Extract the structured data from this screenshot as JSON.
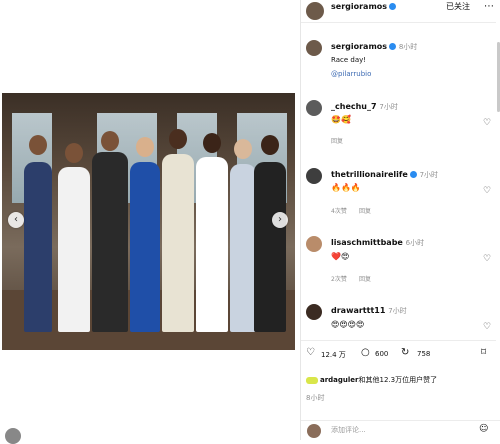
{
  "header": {
    "username": "sergioramos",
    "follow_label": "已关注",
    "more_icon": "more-icon"
  },
  "caption": {
    "username": "sergioramos",
    "time": "8小时",
    "text": "Race day!",
    "mention": "@pilarrubio"
  },
  "comments": [
    {
      "username": "_chechu_7",
      "time": "7小时",
      "emojis": "🤩🥰",
      "sub": [
        "回复"
      ]
    },
    {
      "username": "thetrillionairelife",
      "time": "7小时",
      "emojis": "🔥🔥🔥",
      "sub": [
        "4次赞",
        "回复"
      ]
    },
    {
      "username": "lisaschmittbabe",
      "time": "6小时",
      "emojis": "❤️😍",
      "sub": [
        "2次赞",
        "回复"
      ]
    },
    {
      "username": "drawarttt11",
      "time": "7小时",
      "emojis": "😍😍😍😍"
    }
  ],
  "actions": {
    "likes": "12.4 万",
    "comments": "600",
    "shares": "758"
  },
  "likes_summary": {
    "name": "ardaguler",
    "rest": "和其他12.3万位用户赞了"
  },
  "post_time": "8小时",
  "comment_placeholder": "添加评论..."
}
